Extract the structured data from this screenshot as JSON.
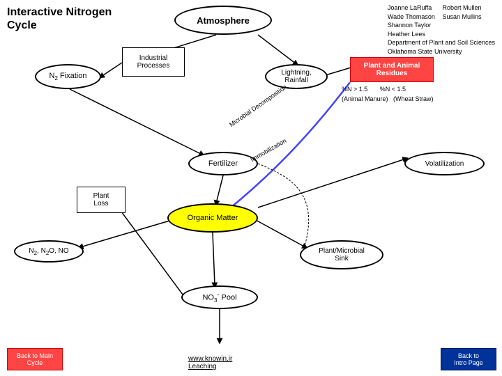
{
  "title": {
    "line1": "Interactive Nitrogen",
    "line2": "Cycle"
  },
  "authors": {
    "col1": "Joanne LaRuffa\nWade Thomason\nShannon Taylor\nHeather Lees",
    "col2": "Robert Mullen\nSusan Mullins",
    "dept": "Department of Plant and Soil Sciences",
    "university": "Oklahoma State University"
  },
  "atmosphere": "Atmosphere",
  "industrial_processes": "Industrial\nProcesses",
  "n2_fixation": "N₂ Fixation",
  "lightning": "Lightning,\nRainfall",
  "plant_animal": "Plant and Animal\nResidues",
  "percent_n1": "%N > 1.5",
  "percent_n1_label": "(Animal Manure)",
  "percent_n2": "%N < 1.5",
  "percent_n2_label": "(Wheat Straw)",
  "microbial_decomp": "Microbial Decomposition",
  "fertilizer": "Fertilizer",
  "immobilization": "Immobilization",
  "volatilization": "Volatilization",
  "plant_loss": "Plant\nLoss",
  "organic_matter": "Organic Matter",
  "n2_gases": "N₂, N₂O, NO",
  "plant_sink": "Plant/Microbial\nSink",
  "no3_pool": "NO₃⁻ Pool",
  "leaching": "Leaching",
  "back_main": "Back to Main\nCycle",
  "www": "www.knowin.ir",
  "back_intro": "Back to\nIntro Page"
}
